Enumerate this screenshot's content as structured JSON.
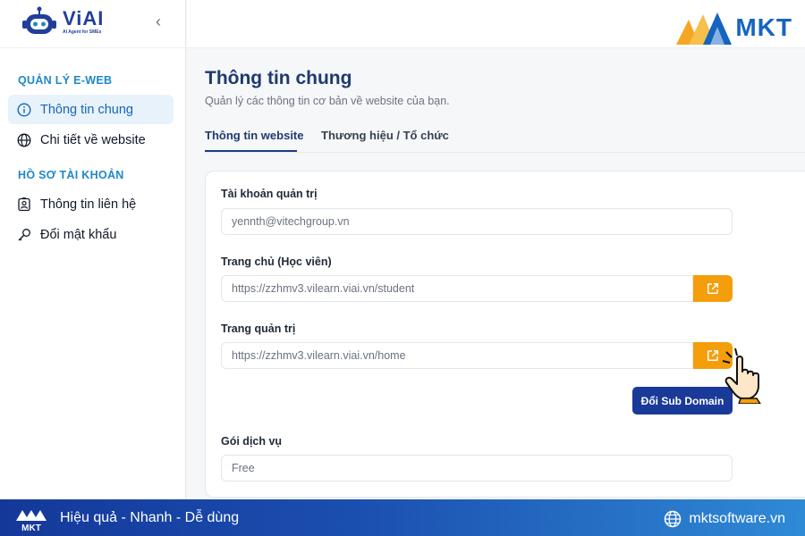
{
  "brand": {
    "name": "ViAI",
    "tagline": "AI Agent for SMEs",
    "partner": "MKT"
  },
  "sidebar": {
    "sections": [
      {
        "title": "QUẢN LÝ E-WEB",
        "items": [
          {
            "label": "Thông tin chung",
            "icon": "info-icon",
            "active": true
          },
          {
            "label": "Chi tiết về website",
            "icon": "globe-icon",
            "active": false
          }
        ]
      },
      {
        "title": "HỒ SƠ TÀI KHOẢN",
        "items": [
          {
            "label": "Thông tin liên hệ",
            "icon": "contact-icon",
            "active": false
          },
          {
            "label": "Đổi mật khẩu",
            "icon": "key-icon",
            "active": false
          }
        ]
      }
    ]
  },
  "page": {
    "title": "Thông tin chung",
    "subtitle": "Quản lý các thông tin cơ bản về website của bạn.",
    "tabs": [
      {
        "label": "Thông tin website",
        "active": true
      },
      {
        "label": "Thương hiệu / Tổ chức",
        "active": false
      }
    ]
  },
  "form": {
    "admin_account_label": "Tài khoản quản trị",
    "admin_account_value": "yennth@vitechgroup.vn",
    "homepage_label": "Trang chủ (Học viên)",
    "homepage_value": "https://zzhmv3.vilearn.viai.vn/student",
    "admin_page_label": "Trang quản trị",
    "admin_page_value": "https://zzhmv3.vilearn.viai.vn/home",
    "change_subdomain_label": "Đổi Sub Domain",
    "service_plan_label": "Gói dịch vụ",
    "service_plan_value": "Free"
  },
  "footer": {
    "slogan": "Hiệu quả - Nhanh - Dễ dùng",
    "website": "mktsoftware.vn"
  },
  "colors": {
    "primary": "#1a3a99",
    "accent_orange": "#f59e0b",
    "active_bg": "#e8f2fb",
    "section_blue": "#1e88c8"
  }
}
